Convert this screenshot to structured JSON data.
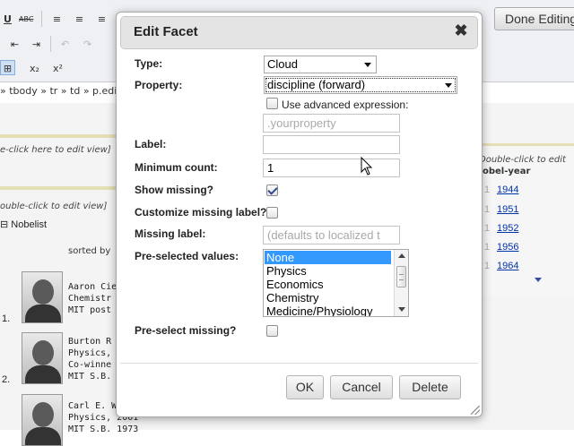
{
  "toolbar": {
    "row1": [
      "U",
      "ABC",
      "≡",
      "≡",
      "≡"
    ],
    "row2": [
      "⇤",
      "⇥",
      "↶",
      "↷"
    ],
    "row3": [
      "⊞",
      "x₂",
      "x²"
    ],
    "done_label": "Done Editing"
  },
  "breadcrumb": "» tbody » tr » td » p.edit-l",
  "background": {
    "hint_left_1": "e-click here to edit view]",
    "hint_left_2": "ouble-click to edit view]",
    "hint_right": "Double-click to edit",
    "nobelist_label": "Nobelist",
    "sorted_by": "sorted by",
    "nobel_year_header": "obel-year",
    "entries": [
      {
        "number": "1.",
        "lines": [
          "Aaron Cie",
          "Chemistr",
          "MIT post"
        ]
      },
      {
        "number": "2.",
        "lines": [
          "Burton R",
          "Physics,",
          "Co-winne",
          "MIT S.B."
        ]
      },
      {
        "number": "",
        "lines": [
          "Carl E. W",
          "Physics, 2001",
          "MIT S.B. 1973"
        ]
      }
    ],
    "years": [
      {
        "n": "1",
        "year": "1944"
      },
      {
        "n": "1",
        "year": "1951"
      },
      {
        "n": "1",
        "year": "1952"
      },
      {
        "n": "1",
        "year": "1956"
      },
      {
        "n": "1",
        "year": "1964"
      }
    ]
  },
  "dialog": {
    "title": "Edit Facet",
    "close_glyph": "✖",
    "type_label": "Type:",
    "type_value": "Cloud",
    "property_label": "Property:",
    "property_value": "discipline (forward)",
    "advanced_label": "Use advanced expression:",
    "expression_placeholder": ".yourproperty",
    "label_label": "Label:",
    "label_value": "",
    "min_count_label": "Minimum count:",
    "min_count_value": "1",
    "show_missing_label": "Show missing?",
    "show_missing_checked": true,
    "customize_missing_label": "Customize missing label?",
    "customize_missing_checked": false,
    "missing_label_label": "Missing label:",
    "missing_label_placeholder": "(defaults to localized t",
    "preselected_label": "Pre-selected values:",
    "preselected_options": [
      "None",
      "Physics",
      "Economics",
      "Chemistry",
      "Medicine/Physiology"
    ],
    "preselected_selected": "None",
    "preselect_missing_label": "Pre-select missing?",
    "preselect_missing_checked": false,
    "ok_label": "OK",
    "cancel_label": "Cancel",
    "delete_label": "Delete"
  }
}
